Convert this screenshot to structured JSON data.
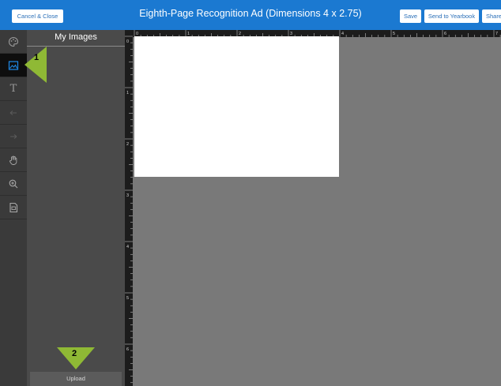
{
  "topbar": {
    "cancel_label": "Cancel & Close",
    "title": "Eighth-Page Recognition Ad (Dimensions 4 x 2.75)",
    "save_label": "Save",
    "send_label": "Send to Yearbook",
    "share_label": "Share"
  },
  "tools": [
    {
      "name": "background-tool",
      "icon": "palette-icon"
    },
    {
      "name": "images-tool",
      "icon": "image-icon",
      "active": true
    },
    {
      "name": "text-tool",
      "icon": "text-icon",
      "glyph": "T"
    },
    {
      "name": "undo-tool",
      "icon": "undo-icon"
    },
    {
      "name": "redo-tool",
      "icon": "redo-icon"
    },
    {
      "name": "pan-tool",
      "icon": "hand-icon"
    },
    {
      "name": "zoom-tool",
      "icon": "zoom-icon"
    },
    {
      "name": "export-tool",
      "icon": "document-icon"
    }
  ],
  "panel": {
    "title": "My Images",
    "upload_label": "Upload"
  },
  "ruler": {
    "top_labels": [
      "0",
      "1",
      "2",
      "3",
      "4",
      "5",
      "6",
      "7"
    ],
    "left_labels": [
      "0",
      "1",
      "2",
      "3",
      "4",
      "5",
      "6"
    ]
  },
  "callouts": [
    {
      "number": "1"
    },
    {
      "number": "2"
    }
  ],
  "colors": {
    "topbar": "#1b79d1",
    "callout": "#8fb935",
    "toolstrip": "#3a3a3a",
    "panel": "#4a4a4a",
    "canvas": "#797979"
  }
}
